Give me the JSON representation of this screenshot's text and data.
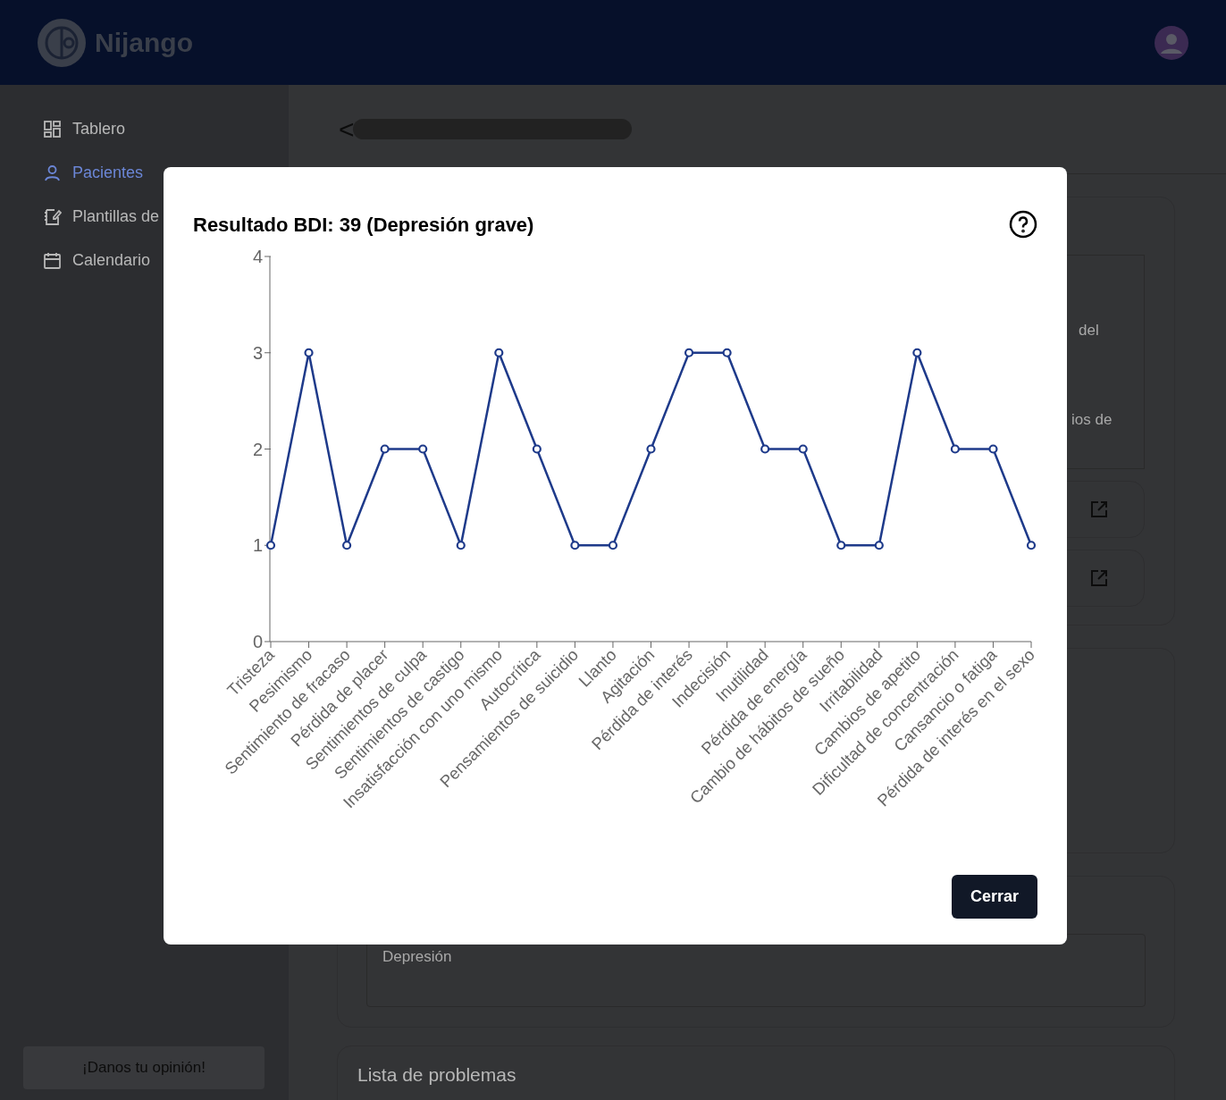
{
  "header": {
    "app_name": "Nijango"
  },
  "sidebar": {
    "items": [
      {
        "label": "Tablero",
        "selected": false
      },
      {
        "label": "Pacientes",
        "selected": true
      },
      {
        "label": "Plantillas de",
        "selected": false
      },
      {
        "label": "Calendario",
        "selected": false
      }
    ],
    "feedback_button": "¡Danos tu opinión!"
  },
  "page": {
    "back": "<",
    "text_fragments": [
      "del",
      "ios de"
    ],
    "diagnosis": "Depresión",
    "problems_title": "Lista de problemas"
  },
  "modal": {
    "title": "Resultado BDI: 39 (Depresión grave)",
    "close_button": "Cerrar",
    "chart_data": {
      "type": "line",
      "categories": [
        "Tristeza",
        "Pesimismo",
        "Sentimiento de fracaso",
        "Pérdida de placer",
        "Sentimientos de culpa",
        "Sentimientos de castigo",
        "Insatisfacción con uno mismo",
        "Autocrítica",
        "Pensamientos de suicidio",
        "Llanto",
        "Agitación",
        "Pérdida de interés",
        "Indecisión",
        "Inutilidad",
        "Pérdida de energía",
        "Cambio de hábitos de sueño",
        "Irritabilidad",
        "Cambios de apetito",
        "Dificultad de concentración",
        "Cansancio o fatiga",
        "Pérdida de interés en el sexo"
      ],
      "series": [
        {
          "color": "#1e3a8a",
          "marker": true,
          "values": [
            1,
            3,
            1,
            2,
            2,
            1,
            3,
            2,
            1,
            1,
            2,
            3,
            3,
            2,
            2,
            1,
            1,
            3,
            2,
            2,
            1
          ]
        }
      ],
      "ylim": [
        0,
        4
      ],
      "yticks": [
        0,
        1,
        2,
        3,
        4
      ]
    }
  }
}
